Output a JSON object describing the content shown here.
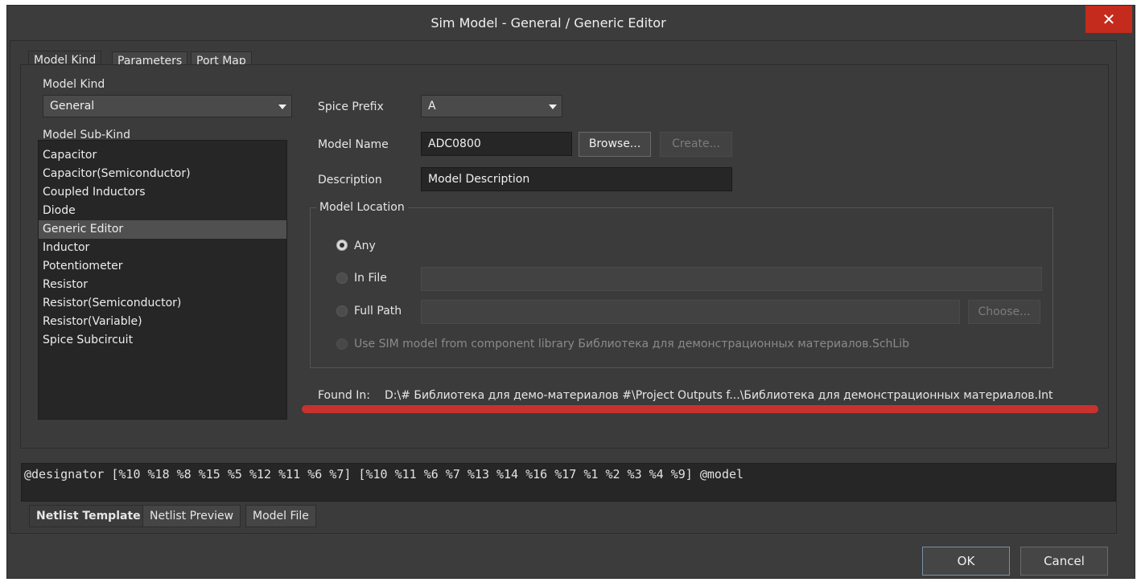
{
  "window": {
    "title": "Sim Model - General / Generic Editor",
    "close_glyph": "✕"
  },
  "top_tabs": [
    {
      "label": "Model Kind",
      "active": true
    },
    {
      "label": "Parameters",
      "active": false
    },
    {
      "label": "Port Map",
      "active": false
    }
  ],
  "model_kind": {
    "label": "Model Kind",
    "value": "General"
  },
  "model_sub_kind": {
    "label": "Model Sub-Kind",
    "items": [
      "Capacitor",
      "Capacitor(Semiconductor)",
      "Coupled Inductors",
      "Diode",
      "Generic Editor",
      "Inductor",
      "Potentiometer",
      "Resistor",
      "Resistor(Semiconductor)",
      "Resistor(Variable)",
      "Spice Subcircuit"
    ],
    "selected": "Generic Editor"
  },
  "spice_prefix": {
    "label": "Spice Prefix",
    "value": "A"
  },
  "model_name": {
    "label": "Model Name",
    "value": "ADC0800",
    "browse_label": "Browse...",
    "create_label": "Create..."
  },
  "description": {
    "label": "Description",
    "value": "Model Description"
  },
  "model_location": {
    "title": "Model Location",
    "any_label": "Any",
    "in_file_label": "In File",
    "full_path_label": "Full Path",
    "choose_label": "Choose...",
    "use_sim_label": "Use SIM model from component library Библиотека для демонстрационных материалов.SchLib",
    "selected": "Any"
  },
  "found_in": {
    "label": "Found In:",
    "path": "D:\\# Библиотека для демо-материалов #\\Project Outputs f...\\Библиотека для демонстрационных материалов.Int",
    "highlight_color": "#c8322d"
  },
  "netlist_template": "@designator [%10 %18 %8 %15 %5 %12 %11 %6 %7] [%10 %11 %6 %7 %13 %14 %16 %17 %1 %2 %3 %4 %9] @model",
  "bottom_tabs": [
    {
      "label": "Netlist Template",
      "active": true
    },
    {
      "label": "Netlist Preview",
      "active": false
    },
    {
      "label": "Model File",
      "active": false
    }
  ],
  "buttons": {
    "ok": "OK",
    "cancel": "Cancel"
  },
  "icons": {
    "dropdown": "chevron-down-icon",
    "close": "close-icon"
  }
}
